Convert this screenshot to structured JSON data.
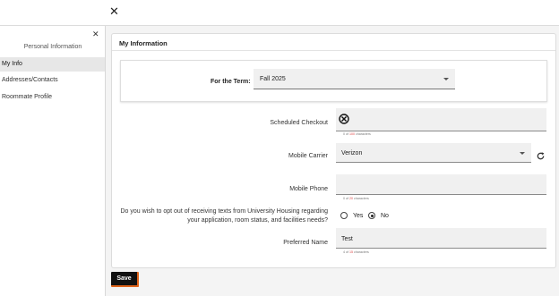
{
  "sidebar": {
    "heading": "Personal Information",
    "items": [
      {
        "label": "My Info"
      },
      {
        "label": "Addresses/Contacts"
      },
      {
        "label": "Roommate Profile"
      }
    ]
  },
  "main": {
    "title": "My Information",
    "term": {
      "label": "For the Term:",
      "value": "Fall 2025"
    },
    "fields": {
      "scheduled_checkout": {
        "label": "Scheduled Checkout",
        "count_current": "0",
        "count_of": "of",
        "count_max": "100",
        "count_suffix": "characters"
      },
      "mobile_carrier": {
        "label": "Mobile Carrier",
        "value": "Verizon"
      },
      "mobile_phone": {
        "label": "Mobile Phone",
        "count_current": "0",
        "count_of": "of",
        "count_max": "20",
        "count_suffix": "characters"
      },
      "opt_out": {
        "label_line1": "Do you wish to opt out of receiving texts from University Housing regarding",
        "label_line2": "your application, room status, and facilities needs?",
        "options": [
          {
            "label": "Yes",
            "selected": false
          },
          {
            "label": "No",
            "selected": true
          }
        ]
      },
      "preferred_name": {
        "label": "Preferred Name",
        "value": "Test",
        "count_current": "4",
        "count_of": "of",
        "count_max": "15",
        "count_suffix": "characters"
      }
    }
  },
  "footer": {
    "save_label": "Save"
  },
  "icons": {
    "top_close": "close-icon",
    "sidebar_close": "close-icon",
    "refresh": "refresh-icon",
    "disabled": "not-allowed-icon"
  },
  "colors": {
    "accent": "#e0641b",
    "save_bg": "#111111"
  }
}
